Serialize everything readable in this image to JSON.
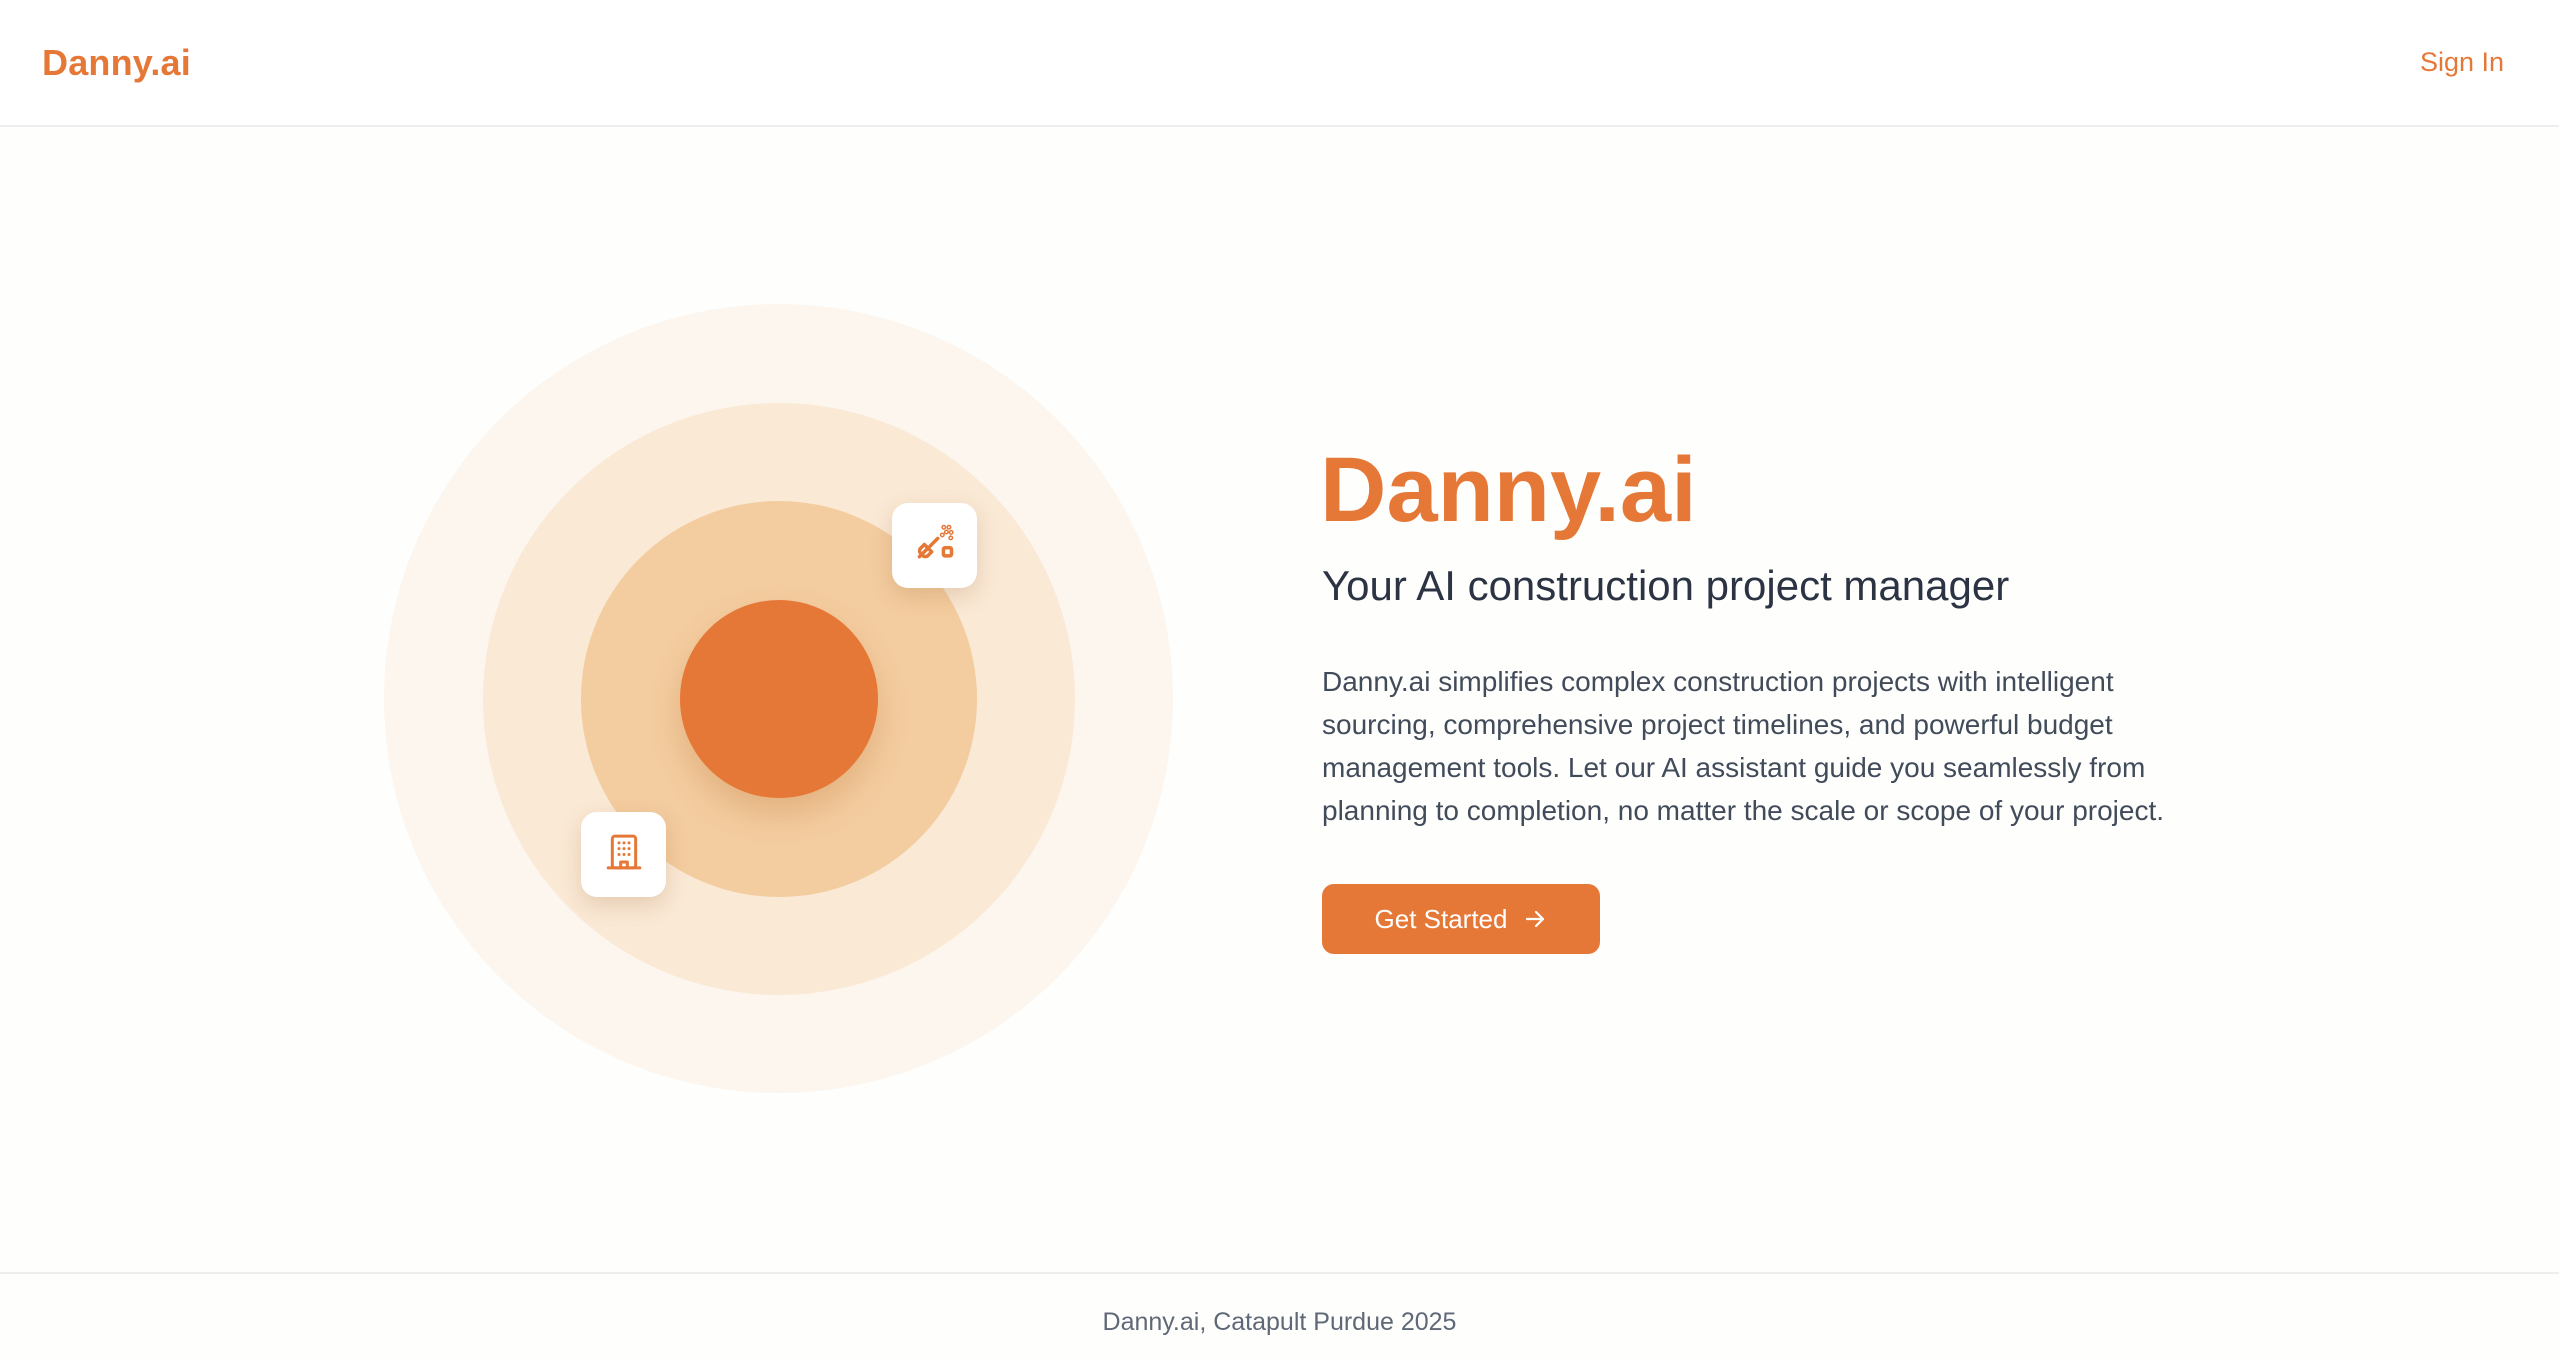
{
  "header": {
    "logo": "Danny.ai",
    "signin_label": "Sign In"
  },
  "illustration": {
    "icons": [
      "shovel-icon",
      "building-icon"
    ],
    "colors": {
      "accent": "#e67837",
      "ring_outer": "#fcf6ef",
      "ring_middle": "#fae9d5",
      "ring_inner": "#f3cc9f"
    }
  },
  "hero": {
    "title": "Danny.ai",
    "subtitle": "Your AI construction project manager",
    "body": "Danny.ai simplifies complex construction projects with intelligent sourcing, comprehensive project timelines, and powerful budget management tools. Let our AI assistant guide you seamlessly from planning to completion, no matter the scale or scope of your project.",
    "cta_label": "Get Started",
    "cta_icon": "arrow-right-icon"
  },
  "footer": {
    "text": "Danny.ai, Catapult Purdue 2025"
  }
}
